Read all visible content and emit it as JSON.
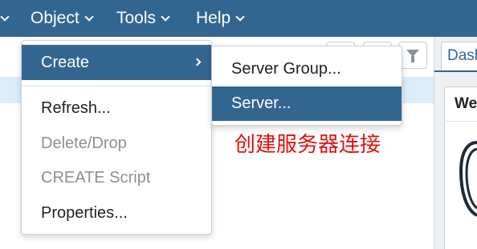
{
  "menubar": {
    "items": [
      {
        "label": "Object"
      },
      {
        "label": "Tools"
      },
      {
        "label": "Help"
      }
    ]
  },
  "dropdown": {
    "items": [
      {
        "label": "Create",
        "state": "active",
        "has_submenu": true
      },
      {
        "label": "Refresh...",
        "state": "enabled"
      },
      {
        "label": "Delete/Drop",
        "state": "disabled"
      },
      {
        "label": "CREATE Script",
        "state": "disabled"
      },
      {
        "label": "Properties...",
        "state": "enabled"
      }
    ]
  },
  "submenu": {
    "items": [
      {
        "label": "Server Group...",
        "state": "enabled"
      },
      {
        "label": "Server...",
        "state": "active"
      }
    ]
  },
  "annotation": {
    "text": "创建服务器连接",
    "color": "#e01010"
  },
  "right_panel": {
    "tab_label": "Dash",
    "card_title": "We"
  },
  "icons": [
    "chevron-down-icon",
    "chevron-right-icon",
    "filter-icon",
    "postgres-elephant-logo"
  ],
  "colors": {
    "accent": "#326690",
    "selected_row": "#dbeefa"
  }
}
